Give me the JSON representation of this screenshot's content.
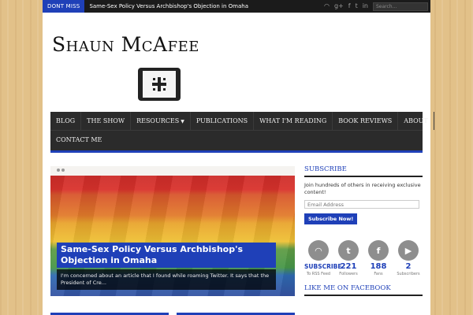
{
  "topbar": {
    "dont_miss": "DONT MISS",
    "ticker": "Same-Sex Policy Versus Archbishop's Objection in Omaha",
    "search_placeholder": "Search...",
    "icons": [
      "rss-icon",
      "google-plus-icon",
      "facebook-icon",
      "twitter-icon",
      "linkedin-icon"
    ]
  },
  "site": {
    "title": "Shaun McAfee"
  },
  "nav": {
    "row1": [
      {
        "label": "Blog"
      },
      {
        "label": "The Show"
      },
      {
        "label": "Resources",
        "dropdown": true
      },
      {
        "label": "Publications"
      },
      {
        "label": "What I'm Reading"
      },
      {
        "label": "Book Reviews"
      },
      {
        "label": "About"
      }
    ],
    "row2": [
      {
        "label": "Contact Me"
      }
    ]
  },
  "featured": {
    "title": "Same-Sex Policy Versus Archbishop's Objection in Omaha",
    "excerpt": "I'm concerned about an article that I found while roaming Twitter. It says that the President of Cre..."
  },
  "sidebar": {
    "subscribe_title": "Subscribe",
    "subscribe_desc": "Join hundreds of others in receiving exclusive content!",
    "email_placeholder": "Email Address",
    "subscribe_button": "Subscribe Now!",
    "social": [
      {
        "icon": "rss-icon",
        "glyph": "◠",
        "count": "SUBSCRIBE",
        "label": "To RSS Feed",
        "small": true
      },
      {
        "icon": "twitter-icon",
        "glyph": "t",
        "count": "221",
        "label": "Followers"
      },
      {
        "icon": "facebook-icon",
        "glyph": "f",
        "count": "188",
        "label": "Fans"
      },
      {
        "icon": "youtube-icon",
        "glyph": "▶",
        "count": "2",
        "label": "Subscribers"
      }
    ],
    "facebook_title": "Like me on Facebook"
  },
  "colors": {
    "accent": "#1f40b8",
    "nav_bg": "#2b2b2b",
    "topbar_bg": "#1b1b1b"
  }
}
